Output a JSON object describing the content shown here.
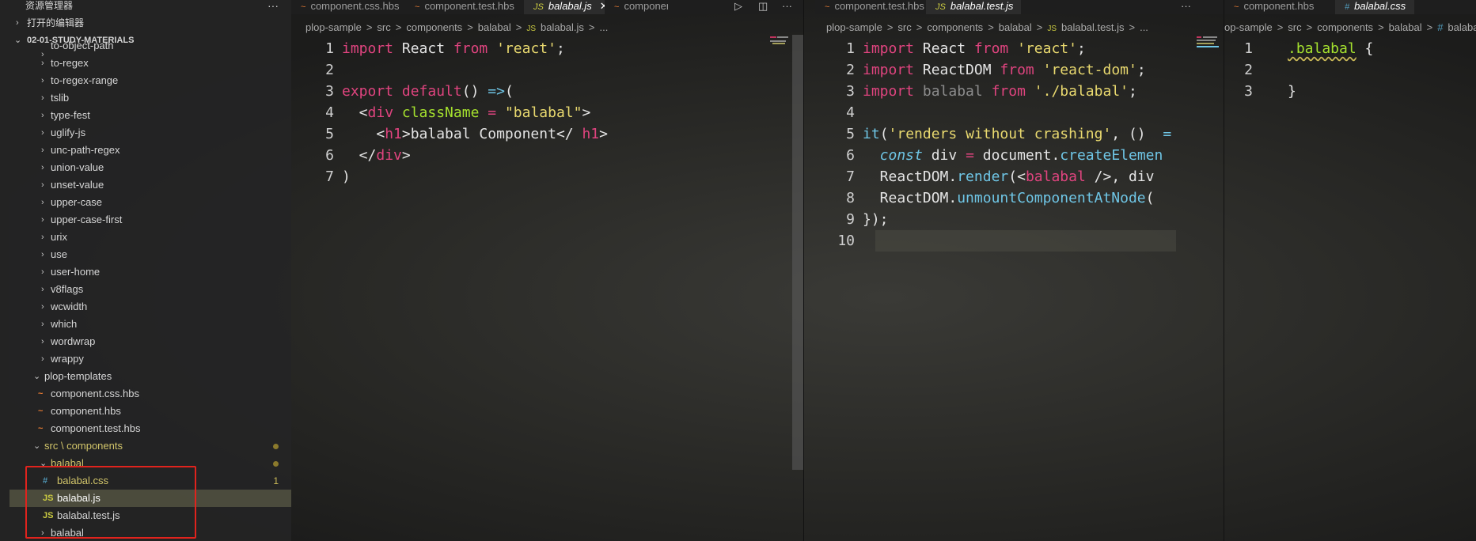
{
  "sidebar": {
    "title": "资源管理器",
    "more": "···",
    "open_editors": "打开的编辑器",
    "workspace": "02-01-STUDY-MATERIALS",
    "partial_top": "to-object-path",
    "packages": [
      "to-regex",
      "to-regex-range",
      "tslib",
      "type-fest",
      "uglify-js",
      "unc-path-regex",
      "union-value",
      "unset-value",
      "upper-case",
      "upper-case-first",
      "urix",
      "use",
      "user-home",
      "v8flags",
      "wcwidth",
      "which",
      "wordwrap",
      "wrappy"
    ],
    "plop_templates": "plop-templates",
    "templates": [
      "component.css.hbs",
      "component.hbs",
      "component.test.hbs"
    ],
    "src_components": "src \\ components",
    "balabal_folder": "balabal",
    "balabal_files": [
      {
        "name": "balabal.css",
        "icon": "#",
        "problems": "1"
      },
      {
        "name": "balabal.js",
        "icon": "JS"
      },
      {
        "name": "balabal.test.js",
        "icon": "JS"
      }
    ],
    "partial_bottom": "balabal",
    "accent_box": "#e0231d"
  },
  "pane1": {
    "tabs": [
      {
        "label": "component.css.hbs",
        "icon": "~"
      },
      {
        "label": "component.test.hbs",
        "icon": "~"
      },
      {
        "label": "balabal.js",
        "icon": "JS",
        "close": "✕"
      },
      {
        "label": "componer",
        "icon": "~"
      }
    ],
    "actions": [
      "▷",
      "◫",
      "···"
    ],
    "breadcrumb": [
      "plop-sample",
      ">",
      "src",
      ">",
      "components",
      ">",
      "balabal",
      ">",
      "JS",
      "balabal.js",
      ">",
      "..."
    ]
  },
  "pane2": {
    "tabs": [
      {
        "label": "component.test.hbs",
        "icon": "~"
      },
      {
        "label": "balabal.test.js",
        "icon": "JS",
        "close": "✕"
      }
    ],
    "actions": [
      "···"
    ],
    "breadcrumb": [
      "plop-sample",
      ">",
      "src",
      ">",
      "components",
      ">",
      "balabal",
      ">",
      "JS",
      "balabal.test.js",
      ">",
      "..."
    ]
  },
  "pane3": {
    "tabs": [
      {
        "label": "component.hbs",
        "icon": "~"
      },
      {
        "label": "balabal.css",
        "icon": "#",
        "close": "✕"
      }
    ],
    "breadcrumb": [
      "op-sample",
      ">",
      "src",
      ">",
      "components",
      ">",
      "balabal",
      ">",
      "#",
      "balabal.c"
    ]
  },
  "code1": [
    [
      [
        "kw",
        "import"
      ],
      [
        "",
        "React"
      ],
      [
        "kw",
        "from"
      ],
      [
        "str",
        "'react'"
      ],
      [
        "",
        ";"
      ]
    ],
    [],
    [
      [
        "kw",
        "export"
      ],
      [
        "kw",
        "default"
      ],
      [
        "",
        "()"
      ],
      [
        "fn",
        "=>"
      ],
      [
        "",
        "("
      ]
    ],
    [
      [
        "",
        "  <"
      ],
      [
        "tag",
        "div"
      ],
      [
        "attr",
        " className"
      ],
      [
        "kw",
        "="
      ],
      [
        "str",
        "\"balabal\""
      ],
      [
        "",
        ">"
      ]
    ],
    [
      [
        "",
        "    <"
      ],
      [
        "tag",
        "h1"
      ],
      [
        "",
        ">balabal Component</"
      ],
      [
        "tag",
        "h1"
      ],
      [
        "",
        ">"
      ]
    ],
    [
      [
        "",
        "  </"
      ],
      [
        "tag",
        "div"
      ],
      [
        "",
        ">"
      ]
    ],
    [
      [
        "",
        ")"
      ]
    ]
  ],
  "code2": [
    [
      [
        "kw",
        "import"
      ],
      [
        "",
        "React"
      ],
      [
        "kw",
        "from"
      ],
      [
        "str",
        "'react'"
      ],
      [
        "",
        ";"
      ]
    ],
    [
      [
        "kw",
        "import"
      ],
      [
        "",
        "ReactDOM"
      ],
      [
        "kw",
        "from"
      ],
      [
        "str",
        "'react-dom'"
      ],
      [
        "",
        ";"
      ]
    ],
    [
      [
        "kw",
        "import"
      ],
      [
        "dim",
        "balabal"
      ],
      [
        "kw",
        "from"
      ],
      [
        "str",
        "'./balabal'"
      ],
      [
        "",
        ";"
      ]
    ],
    [],
    [
      [
        "fn",
        "it"
      ],
      [
        "",
        "("
      ],
      [
        "str",
        "'renders without crashing'"
      ],
      [
        "",
        ", () "
      ],
      [
        "fn",
        "="
      ]
    ],
    [
      [
        "it",
        "  const"
      ],
      [
        "",
        "div"
      ],
      [
        "kw",
        "="
      ],
      [
        "",
        "document."
      ],
      [
        "fn",
        "createElemen"
      ]
    ],
    [
      [
        "",
        "  ReactDOM."
      ],
      [
        "fn",
        "render"
      ],
      [
        "",
        "(<"
      ],
      [
        "tag",
        "balabal"
      ],
      [
        "",
        "/>, div"
      ]
    ],
    [
      [
        "",
        "  ReactDOM."
      ],
      [
        "fn",
        "unmountComponentAtNode"
      ],
      [
        "",
        "("
      ]
    ],
    [
      [
        "",
        "});"
      ]
    ],
    []
  ],
  "code3": [
    [
      [
        "cls",
        ".balabal"
      ],
      [
        "",
        "{"
      ]
    ],
    [],
    [
      [
        "",
        "}"
      ]
    ]
  ]
}
